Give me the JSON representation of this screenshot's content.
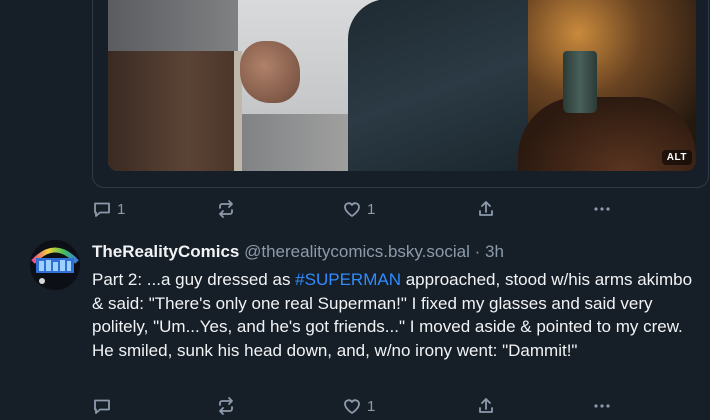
{
  "post1": {
    "alt_badge": "ALT",
    "actions": {
      "reply_count": "1",
      "like_count": "1"
    }
  },
  "post2": {
    "display_name": "TheRealityComics",
    "handle": "@therealitycomics.bsky.social",
    "separator": "·",
    "time": "3h",
    "body_before": "Part 2: ...a guy dressed as ",
    "hashtag": "#SUPERMAN",
    "body_after": " approached, stood w/his arms akimbo & said: \"There's only one real Superman!\" I fixed my glasses and said very politely, \"Um...Yes, and he's got friends...\" I moved aside & pointed to my crew. He smiled, sunk his head down, and, w/no irony went: \"Dammit!\"",
    "actions": {
      "reply_count": "",
      "like_count": "1"
    }
  },
  "icons": [
    "reply-icon",
    "repost-icon",
    "like-icon",
    "share-icon",
    "more-icon"
  ],
  "colors": {
    "background": "#161e27",
    "muted": "#8c9aab",
    "link": "#2f8cff",
    "text": "#f1f3f5"
  }
}
